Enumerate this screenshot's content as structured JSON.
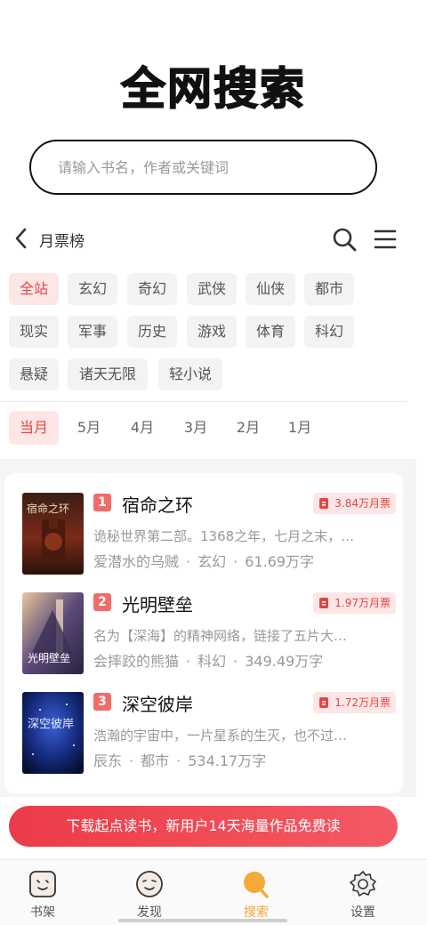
{
  "header": {
    "title": "全网搜索"
  },
  "search": {
    "placeholder": "请输入书名，作者或关键词"
  },
  "ranking": {
    "title": "月票榜"
  },
  "categories": [
    {
      "label": "全站",
      "active": true
    },
    {
      "label": "玄幻"
    },
    {
      "label": "奇幻"
    },
    {
      "label": "武侠"
    },
    {
      "label": "仙侠"
    },
    {
      "label": "都市"
    },
    {
      "label": "现实"
    },
    {
      "label": "军事"
    },
    {
      "label": "历史"
    },
    {
      "label": "游戏"
    },
    {
      "label": "体育"
    },
    {
      "label": "科幻"
    },
    {
      "label": "悬疑"
    },
    {
      "label": "诸天无限"
    },
    {
      "label": "轻小说"
    }
  ],
  "months": [
    {
      "label": "当月",
      "active": true
    },
    {
      "label": "5月"
    },
    {
      "label": "4月"
    },
    {
      "label": "3月"
    },
    {
      "label": "2月"
    },
    {
      "label": "1月"
    }
  ],
  "books": [
    {
      "rank": "1",
      "title": "宿命之环",
      "votes": "3.84万月票",
      "desc": "诡秘世界第二部。1368之年，七月之末，…",
      "author": "爱潜水的乌贼",
      "genre": "玄幻",
      "words": "61.69万字",
      "cover_text": "宿命之环"
    },
    {
      "rank": "2",
      "title": "光明壁垒",
      "votes": "1.97万月票",
      "desc": "名为【深海】的精神网络，链接了五片大…",
      "author": "会摔跤的熊猫",
      "genre": "科幻",
      "words": "349.49万字",
      "cover_text": "光明壁垒"
    },
    {
      "rank": "3",
      "title": "深空彼岸",
      "votes": "1.72万月票",
      "desc": "浩瀚的宇宙中，一片星系的生灭，也不过…",
      "author": "辰东",
      "genre": "都市",
      "words": "534.17万字",
      "cover_text": "深空彼岸"
    }
  ],
  "meta_separator": "·",
  "banner": {
    "text": "下载起点读书，新用户14天海量作品免费读"
  },
  "tabs": [
    {
      "label": "书架",
      "icon": "bookshelf-icon"
    },
    {
      "label": "发现",
      "icon": "discover-icon"
    },
    {
      "label": "搜索",
      "icon": "search-tab-icon",
      "active": true
    },
    {
      "label": "设置",
      "icon": "gear-icon"
    }
  ],
  "colors": {
    "accent": "#e54545",
    "accent_bg": "#fde6e6",
    "tab_active": "#f0a53a",
    "badge": "#f26a6a"
  }
}
